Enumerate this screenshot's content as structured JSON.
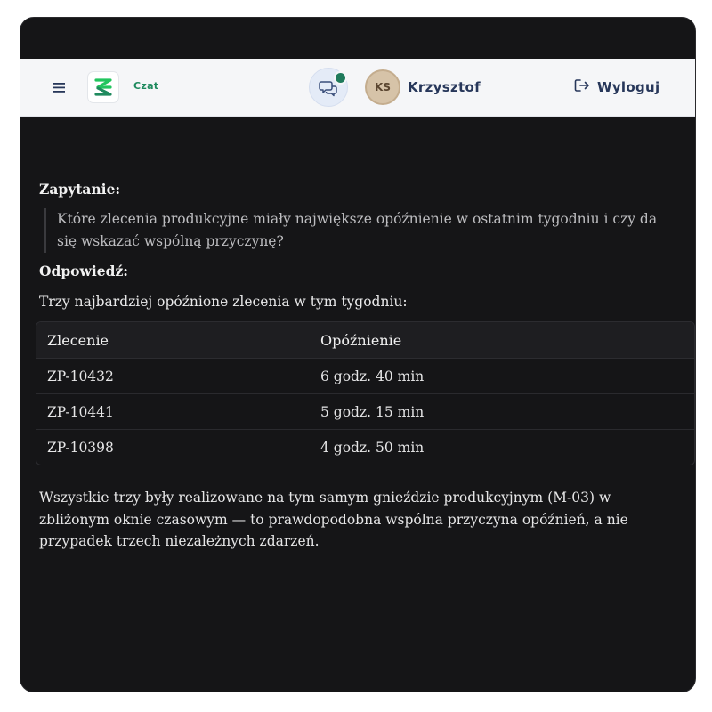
{
  "header": {
    "app_name": "Czat",
    "user_initials": "KS",
    "user_name": "Krzysztof",
    "logout_label": "Wyloguj"
  },
  "icons": {
    "menu": "hamburger-menu-icon",
    "logo": "app-logo",
    "chat": "chat-bubbles-icon",
    "status": "online-status-dot",
    "logout": "logout-icon"
  },
  "colors": {
    "page_background": "#151517",
    "topbar_background": "#f5f6f8",
    "brand_green": "#1f8a5e",
    "header_text": "#27375a",
    "avatar_background": "#d6c3a8"
  },
  "conversation": {
    "question_label": "Zapytanie:",
    "question_text": "Które zlecenia produkcyjne miały największe opóźnienie w ostatnim tygodniu i czy da się wskazać wspólną przyczynę?",
    "answer_label": "Odpowiedź:",
    "answer_intro": "Trzy najbardziej opóźnione zlecenia w tym tygodniu:",
    "table": {
      "headers": [
        "Zlecenie",
        "Opóźnienie"
      ],
      "rows": [
        [
          "ZP-10432",
          "6 godz. 40 min"
        ],
        [
          "ZP-10441",
          "5 godz. 15 min"
        ],
        [
          "ZP-10398",
          "4 godz. 50 min"
        ]
      ]
    },
    "summary": "Wszystkie trzy były realizowane na tym samym gnieździe produkcyjnym (M-03) w zbliżonym oknie czasowym — to prawdopodobna wspólna przyczyna opóźnień, a nie przypadek trzech niezależnych zdarzeń."
  }
}
